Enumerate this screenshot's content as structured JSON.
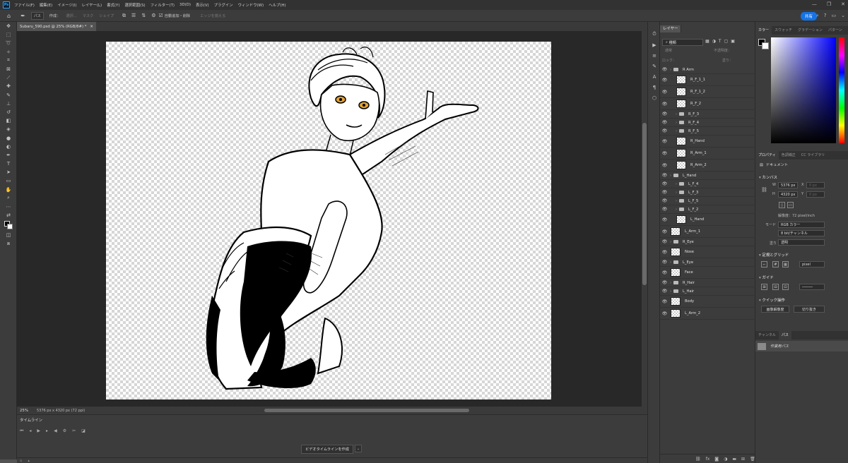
{
  "menubar": {
    "logo": "Ps",
    "items": [
      "ファイル(F)",
      "編集(E)",
      "イメージ(I)",
      "レイヤー(L)",
      "書式(Y)",
      "選択範囲(S)",
      "フィルター(T)",
      "3D(D)",
      "表示(V)",
      "プラグイン",
      "ウィンドウ(W)",
      "ヘルプ(H)"
    ]
  },
  "options": {
    "mode": "パス",
    "make": "作成：",
    "select": "選択...",
    "mask": "マスク",
    "shape": "シェイプ",
    "auto_add": "自動追加・削除",
    "edge_align": "エッジを揃える",
    "share": "共有"
  },
  "document": {
    "tab_title": "Subaru_590.psd @ 25% (RGB/8#) *",
    "zoom": "25%",
    "info": "5376 px x 4320 px (72 ppi)"
  },
  "timeline": {
    "tab": "タイムライン",
    "create_button": "ビデオタイムラインを作成"
  },
  "layers_panel": {
    "tab": "レイヤー",
    "search": "種類",
    "blend_mode": "通常",
    "opacity_label": "不透明度：",
    "lock_label": "ロック：",
    "fill_label": "塗り：",
    "layers": [
      {
        "name": "R Arm",
        "kind": "group",
        "indent": 0
      },
      {
        "name": "R_F_1_1",
        "kind": "layer",
        "indent": 1
      },
      {
        "name": "R_F_1_2",
        "kind": "layer",
        "indent": 1
      },
      {
        "name": "R_F_2",
        "kind": "layer",
        "indent": 1
      },
      {
        "name": "R_F_3",
        "kind": "group",
        "indent": 1
      },
      {
        "name": "R_F_4",
        "kind": "group",
        "indent": 1
      },
      {
        "name": "R_F_5",
        "kind": "group",
        "indent": 1
      },
      {
        "name": "R_Hand",
        "kind": "layer",
        "indent": 1
      },
      {
        "name": "R_Arm_1",
        "kind": "layer",
        "indent": 1
      },
      {
        "name": "R_Arm_2",
        "kind": "layer",
        "indent": 1
      },
      {
        "name": "L_Hand",
        "kind": "group",
        "indent": 0
      },
      {
        "name": "L_F_4",
        "kind": "group",
        "indent": 1
      },
      {
        "name": "L_F_3",
        "kind": "group",
        "indent": 1
      },
      {
        "name": "L_F_5",
        "kind": "group",
        "indent": 1
      },
      {
        "name": "L_F_2",
        "kind": "group",
        "indent": 1
      },
      {
        "name": "L_Hand",
        "kind": "layer",
        "indent": 1
      },
      {
        "name": "L_Arm_1",
        "kind": "layer",
        "indent": 0
      },
      {
        "name": "R_Eye",
        "kind": "group",
        "indent": 0
      },
      {
        "name": "Nose",
        "kind": "layer",
        "indent": 0
      },
      {
        "name": "L_Eye",
        "kind": "group",
        "indent": 0
      },
      {
        "name": "Face",
        "kind": "layer",
        "indent": 0
      },
      {
        "name": "R_Hair",
        "kind": "group",
        "indent": 0
      },
      {
        "name": "L_Hair",
        "kind": "group",
        "indent": 0
      },
      {
        "name": "Body",
        "kind": "layer",
        "indent": 0
      },
      {
        "name": "L_Arm_2",
        "kind": "layer",
        "indent": 0
      }
    ]
  },
  "color_panel": {
    "tabs": [
      "カラー",
      "スウォッチ",
      "グラデーション",
      "パターン"
    ],
    "foreground": "#000000",
    "background": "#ffffff"
  },
  "properties": {
    "tabs": [
      "プロパティ",
      "色調補正",
      "CC ライブラリ"
    ],
    "doc_label": "ドキュメント",
    "canvas_title": "カンバス",
    "w_label": "W",
    "w_value": "5376 px",
    "h_label": "H",
    "h_value": "4320 px",
    "x_label": "X",
    "y_label": "Y",
    "x_placeholder": "0 px",
    "y_placeholder": "0 px",
    "resolution": "解像度：72 pixel/inch",
    "mode_label": "モード",
    "mode_value": "RGB カラー",
    "depth_value": "8 bit/チャンネル",
    "fill_label": "塗り",
    "fill_value": "透明",
    "rulers_title": "定規とグリッド",
    "ruler_unit": "pixel",
    "guides_title": "ガイド",
    "quick_title": "クイック操作",
    "quick_btn1": "画像解像度",
    "quick_btn2": "切り抜き"
  },
  "paths_panel": {
    "tabs": [
      "チャンネル",
      "パス"
    ],
    "work_path": "作業用パス"
  }
}
